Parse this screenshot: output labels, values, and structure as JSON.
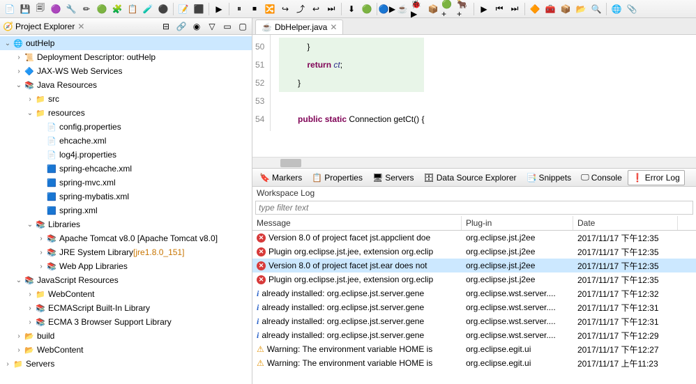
{
  "toolbar_icons": [
    "📄",
    "💾",
    "🗐",
    "🟣",
    "🔧",
    "✏",
    "🟢",
    "🧩",
    "📋",
    "🧪",
    "⚫",
    "|",
    "📝",
    "⬛",
    "|",
    "▶",
    "|",
    "⏸",
    "⏹",
    "🔀",
    "↪",
    "⤴",
    "↩",
    "⏭",
    "|",
    "⬇",
    "🟢",
    "|",
    "🔵▶",
    "☕",
    "🐞▶",
    "📦",
    "🟢+",
    "🐂+",
    "|",
    "▶",
    "⏮",
    "⏭",
    "|",
    "🔶",
    "🧰",
    "📦",
    "📂",
    "🔍",
    "|",
    "🌐",
    "📎"
  ],
  "explorer": {
    "title": "Project Explorer",
    "root": "outHelp",
    "nodes": [
      {
        "depth": 0,
        "tw": "v",
        "icon": "🌐",
        "label": "outHelp",
        "sel": true
      },
      {
        "depth": 1,
        "tw": ">",
        "icon": "📜",
        "label": "Deployment Descriptor: outHelp"
      },
      {
        "depth": 1,
        "tw": ">",
        "icon": "🔷",
        "label": "JAX-WS Web Services"
      },
      {
        "depth": 1,
        "tw": "v",
        "icon": "📚",
        "label": "Java Resources"
      },
      {
        "depth": 2,
        "tw": ">",
        "icon": "📁",
        "label": "src"
      },
      {
        "depth": 2,
        "tw": "v",
        "icon": "📁",
        "label": "resources"
      },
      {
        "depth": 3,
        "tw": "",
        "icon": "📄",
        "label": "config.properties"
      },
      {
        "depth": 3,
        "tw": "",
        "icon": "📄",
        "label": "ehcache.xml"
      },
      {
        "depth": 3,
        "tw": "",
        "icon": "📄",
        "label": "log4j.properties"
      },
      {
        "depth": 3,
        "tw": "",
        "icon": "🟦",
        "label": "spring-ehcache.xml"
      },
      {
        "depth": 3,
        "tw": "",
        "icon": "🟦",
        "label": "spring-mvc.xml"
      },
      {
        "depth": 3,
        "tw": "",
        "icon": "🟦",
        "label": "spring-mybatis.xml"
      },
      {
        "depth": 3,
        "tw": "",
        "icon": "🟦",
        "label": "spring.xml"
      },
      {
        "depth": 2,
        "tw": "v",
        "icon": "📚",
        "label": "Libraries"
      },
      {
        "depth": 3,
        "tw": ">",
        "icon": "📚",
        "label": "Apache Tomcat v8.0 [Apache Tomcat v8.0]"
      },
      {
        "depth": 3,
        "tw": ">",
        "icon": "📚",
        "label": "JRE System Library ",
        "extra": "[jre1.8.0_151]"
      },
      {
        "depth": 3,
        "tw": ">",
        "icon": "📚",
        "label": "Web App Libraries"
      },
      {
        "depth": 1,
        "tw": "v",
        "icon": "📚",
        "label": "JavaScript Resources"
      },
      {
        "depth": 2,
        "tw": ">",
        "icon": "📁",
        "label": "WebContent"
      },
      {
        "depth": 2,
        "tw": ">",
        "icon": "📚",
        "label": "ECMAScript Built-In Library"
      },
      {
        "depth": 2,
        "tw": ">",
        "icon": "📚",
        "label": "ECMA 3 Browser Support Library"
      },
      {
        "depth": 1,
        "tw": ">",
        "icon": "📂",
        "label": "build"
      },
      {
        "depth": 1,
        "tw": ">",
        "icon": "📂",
        "label": "WebContent"
      },
      {
        "depth": 0,
        "tw": ">",
        "icon": "📁",
        "label": "Servers"
      }
    ]
  },
  "editor": {
    "tab": "DbHelper.java",
    "lines": [
      {
        "n": 50,
        "bg": "g",
        "html": "            }"
      },
      {
        "n": 51,
        "bg": "g",
        "html": "            <span class='kw'>return</span> <span class='it'>ct</span>;"
      },
      {
        "n": 52,
        "bg": "g",
        "html": "        }"
      },
      {
        "n": 53,
        "bg": "p",
        "html": ""
      },
      {
        "n": 54,
        "bg": "p",
        "html": "        <span class='kw'>public</span> <span class='kw'>static</span> Connection getCt() {"
      }
    ]
  },
  "bottom": {
    "tabs": [
      "Markers",
      "Properties",
      "Servers",
      "Data Source Explorer",
      "Snippets",
      "Console",
      "Error Log"
    ],
    "tab_icons": [
      "🔖",
      "📋",
      "🖥",
      "🗄",
      "📑",
      "🖵",
      "❗"
    ],
    "active": 6,
    "workspace_label": "Workspace Log",
    "filter_placeholder": "type filter text",
    "headers": [
      "Message",
      "Plug-in",
      "Date"
    ],
    "rows": [
      {
        "t": "err",
        "msg": "Version 8.0 of project facet jst.appclient doe",
        "plugin": "org.eclipse.jst.j2ee",
        "date": "2017/11/17 下午12:35"
      },
      {
        "t": "err",
        "msg": "Plugin org.eclipse.jst.jee, extension org.eclip",
        "plugin": "org.eclipse.jst.j2ee",
        "date": "2017/11/17 下午12:35"
      },
      {
        "t": "err",
        "msg": "Version 8.0 of project facet jst.ear does not",
        "plugin": "org.eclipse.jst.j2ee",
        "date": "2017/11/17 下午12:35",
        "sel": true
      },
      {
        "t": "err",
        "msg": "Plugin org.eclipse.jst.jee, extension org.eclip",
        "plugin": "org.eclipse.jst.j2ee",
        "date": "2017/11/17 下午12:35"
      },
      {
        "t": "info",
        "msg": "already installed: org.eclipse.jst.server.gene",
        "plugin": "org.eclipse.wst.server....",
        "date": "2017/11/17 下午12:32"
      },
      {
        "t": "info",
        "msg": "already installed: org.eclipse.jst.server.gene",
        "plugin": "org.eclipse.wst.server....",
        "date": "2017/11/17 下午12:31"
      },
      {
        "t": "info",
        "msg": "already installed: org.eclipse.jst.server.gene",
        "plugin": "org.eclipse.wst.server....",
        "date": "2017/11/17 下午12:31"
      },
      {
        "t": "info",
        "msg": "already installed: org.eclipse.jst.server.gene",
        "plugin": "org.eclipse.wst.server....",
        "date": "2017/11/17 下午12:29"
      },
      {
        "t": "warn",
        "msg": "Warning: The environment variable HOME is",
        "plugin": "org.eclipse.egit.ui",
        "date": "2017/11/17 下午12:27"
      },
      {
        "t": "warn",
        "msg": "Warning: The environment variable HOME is",
        "plugin": "org.eclipse.egit.ui",
        "date": "2017/11/17 上午11:23"
      }
    ]
  }
}
